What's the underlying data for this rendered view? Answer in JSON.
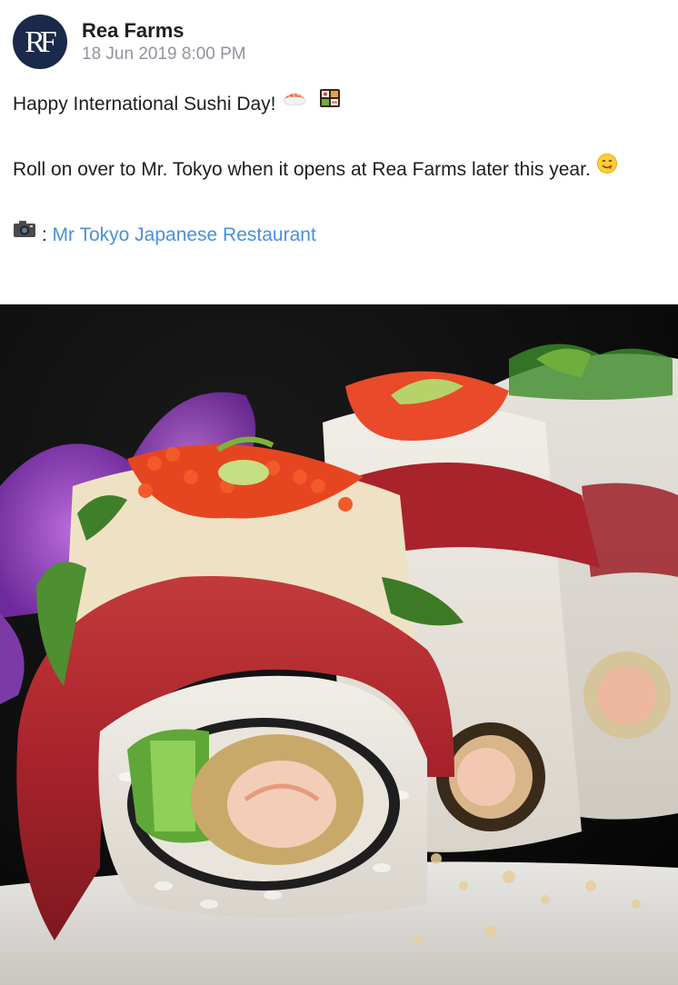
{
  "post": {
    "author": {
      "name": "Rea Farms",
      "avatar_monogram": "RF",
      "avatar_color": "#1b2a4a"
    },
    "timestamp": "18 Jun 2019 8:00 PM",
    "text": {
      "line1": "Happy International Sushi Day!",
      "line2": "Roll on over to Mr. Tokyo when it opens at Rea Farms later this year.",
      "credit_separator": " : ",
      "credit_link": "Mr Tokyo Japanese Restaurant"
    },
    "icons": [
      "sushi-emoji-icon",
      "bento-emoji-icon",
      "smiling-face-emoji-icon",
      "camera-emoji-icon"
    ],
    "link_color": "#4a90d9",
    "photo": {
      "subject": "sushi-rolls-photo"
    }
  }
}
